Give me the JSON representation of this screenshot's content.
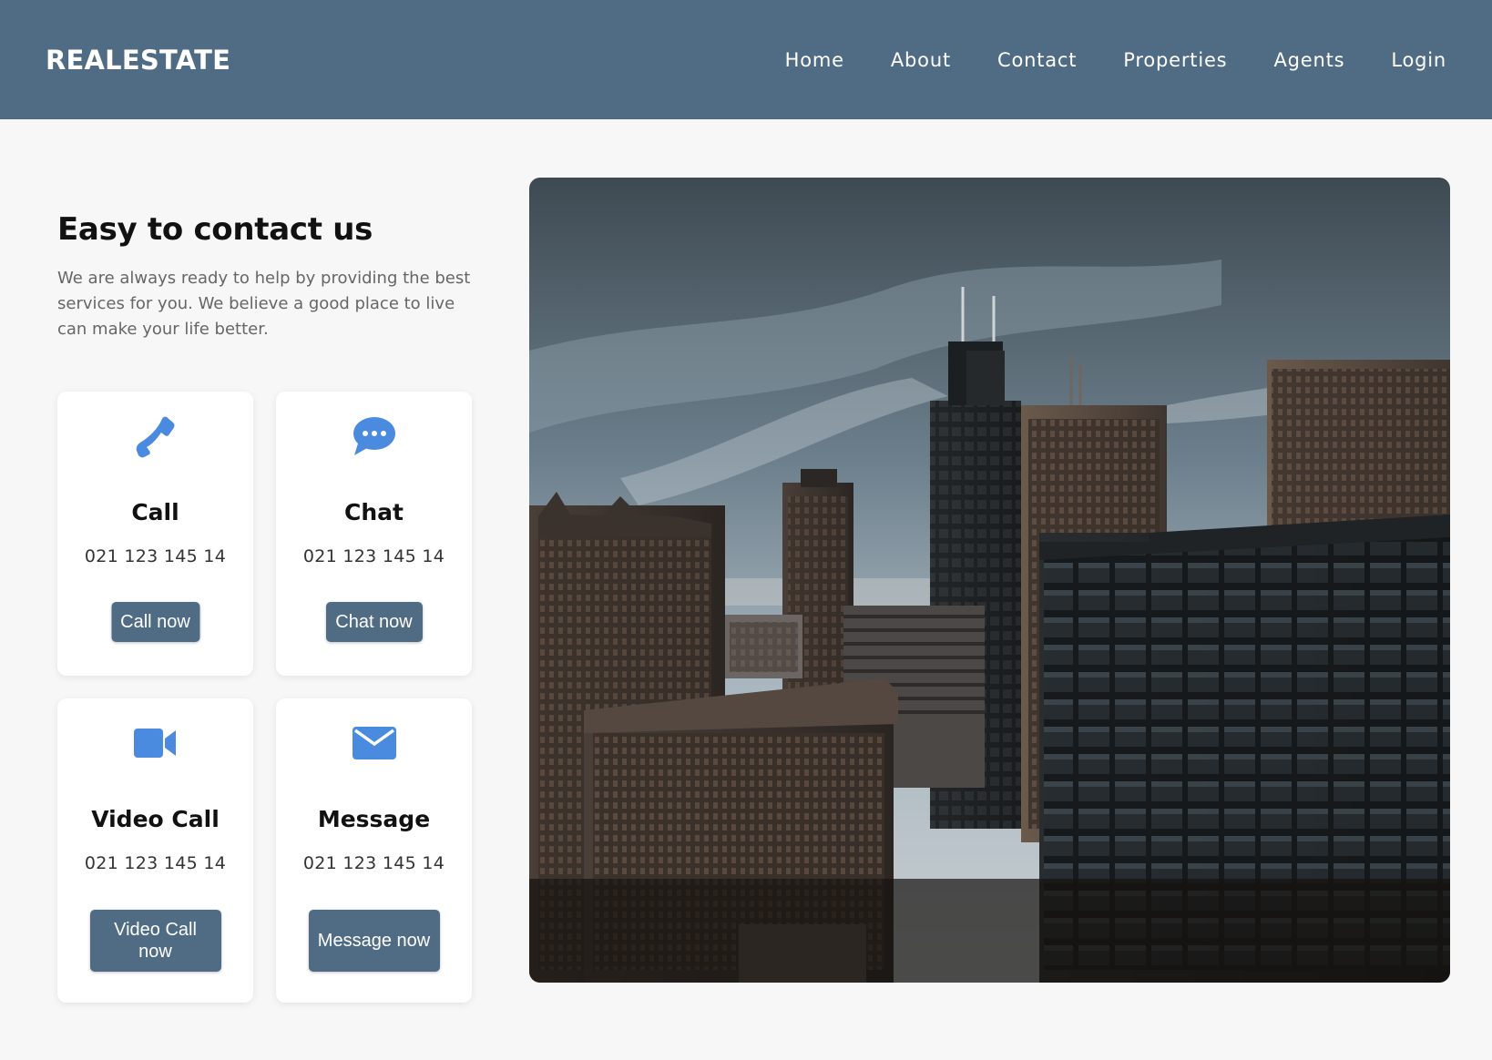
{
  "brand": {
    "logo": "REALESTATE",
    "nav_bg": "#506c85",
    "accent": "#4a8bdf"
  },
  "nav": {
    "links": [
      "Home",
      "About",
      "Contact",
      "Properties",
      "Agents",
      "Login"
    ]
  },
  "contact": {
    "title": "Easy to contact us",
    "description": "We are always ready to help by providing the best services for you. We believe a good place to live can make your life better."
  },
  "cards": [
    {
      "icon": "phone-icon",
      "title": "Call",
      "phone": "021 123 145 14",
      "button": "Call now"
    },
    {
      "icon": "chat-bubble-icon",
      "title": "Chat",
      "phone": "021 123 145 14",
      "button": "Chat now"
    },
    {
      "icon": "video-camera-icon",
      "title": "Video Call",
      "phone": "021 123 145 14",
      "button": "Video Call now"
    },
    {
      "icon": "envelope-icon",
      "title": "Message",
      "phone": "021 123 145 14",
      "button": "Message now"
    }
  ],
  "hero_image": {
    "subject": "city-skyline-photo"
  }
}
